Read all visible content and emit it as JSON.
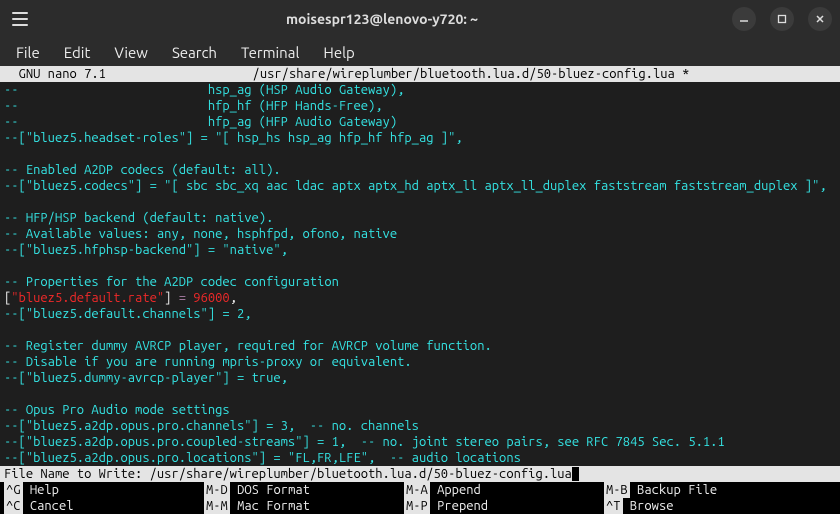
{
  "window": {
    "title": "moisespr123@lenovo-y720: ~"
  },
  "menubar": [
    "File",
    "Edit",
    "View",
    "Search",
    "Terminal",
    "Help"
  ],
  "nano": {
    "header_left": "  GNU nano 7.1",
    "header_mid": "/usr/share/wireplumber/bluetooth.lua.d/50-bluez-config.lua *",
    "lines": [
      {
        "type": "comment",
        "text": "--                          hsp_ag (HSP Audio Gateway),"
      },
      {
        "type": "comment",
        "text": "--                          hfp_hf (HFP Hands-Free),"
      },
      {
        "type": "comment",
        "text": "--                          hfp_ag (HFP Audio Gateway)"
      },
      {
        "type": "comment",
        "text": "--[\"bluez5.headset-roles\"] = \"[ hsp_hs hsp_ag hfp_hf hfp_ag ]\","
      },
      {
        "type": "blank",
        "text": ""
      },
      {
        "type": "comment",
        "text": "-- Enabled A2DP codecs (default: all)."
      },
      {
        "type": "comment",
        "text": "--[\"bluez5.codecs\"] = \"[ sbc sbc_xq aac ldac aptx aptx_hd aptx_ll aptx_ll_duplex faststream faststream_duplex ]\","
      },
      {
        "type": "blank",
        "text": ""
      },
      {
        "type": "comment",
        "text": "-- HFP/HSP backend (default: native)."
      },
      {
        "type": "comment",
        "text": "-- Available values: any, none, hsphfpd, ofono, native"
      },
      {
        "type": "comment",
        "text": "--[\"bluez5.hfphsp-backend\"] = \"native\","
      },
      {
        "type": "blank",
        "text": ""
      },
      {
        "type": "comment",
        "text": "-- Properties for the A2DP codec configuration"
      },
      {
        "type": "active",
        "open": "[",
        "key": "\"bluez5.default.rate\"",
        "close": "]",
        "eq": " = ",
        "val": "96000",
        "tail": ","
      },
      {
        "type": "comment",
        "text": "--[\"bluez5.default.channels\"] = 2,"
      },
      {
        "type": "blank",
        "text": ""
      },
      {
        "type": "comment",
        "text": "-- Register dummy AVRCP player, required for AVRCP volume function."
      },
      {
        "type": "comment",
        "text": "-- Disable if you are running mpris-proxy or equivalent."
      },
      {
        "type": "comment",
        "text": "--[\"bluez5.dummy-avrcp-player\"] = true,"
      },
      {
        "type": "blank",
        "text": ""
      },
      {
        "type": "comment",
        "text": "-- Opus Pro Audio mode settings"
      },
      {
        "type": "comment",
        "text": "--[\"bluez5.a2dp.opus.pro.channels\"] = 3,  -- no. channels"
      },
      {
        "type": "comment",
        "text": "--[\"bluez5.a2dp.opus.pro.coupled-streams\"] = 1,  -- no. joint stereo pairs, see RFC 7845 Sec. 5.1.1"
      },
      {
        "type": "comment",
        "text": "--[\"bluez5.a2dp.opus.pro.locations\"] = \"FL,FR,LFE\",  -- audio locations"
      }
    ],
    "prompt": "File Name to Write: /usr/share/wireplumber/bluetooth.lua.d/50-bluez-config.lua",
    "help": [
      [
        {
          "k": "^G",
          "l": " Help"
        },
        {
          "k": "M-D",
          "l": " DOS Format"
        },
        {
          "k": "M-A",
          "l": " Append"
        },
        {
          "k": "M-B",
          "l": " Backup File"
        }
      ],
      [
        {
          "k": "^C",
          "l": " Cancel"
        },
        {
          "k": "M-M",
          "l": " Mac Format"
        },
        {
          "k": "M-P",
          "l": " Prepend"
        },
        {
          "k": "^T",
          "l": " Browse"
        }
      ]
    ]
  },
  "chart_data": null
}
